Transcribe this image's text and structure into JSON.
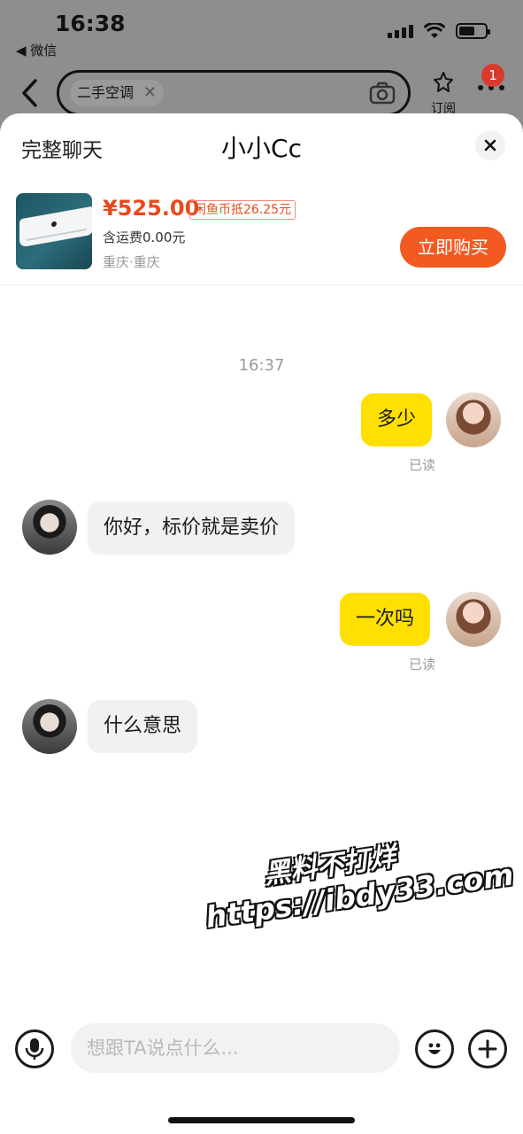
{
  "status_bar": {
    "time": "16:38",
    "back_app": "◀ 微信"
  },
  "search": {
    "query": "二手空调"
  },
  "actions": {
    "subscribe_label": "订阅",
    "notification_count": "1"
  },
  "sheet": {
    "full_chat_label": "完整聊天",
    "title": "小小Cc"
  },
  "product": {
    "price": "¥525.00",
    "coin_discount": "闲鱼币抵26.25元",
    "shipping": "含运费0.00元",
    "location": "重庆·重庆",
    "buy_label": "立即购买"
  },
  "chat": {
    "timestamp": "16:37",
    "messages": [
      {
        "from": "me",
        "text": "多少",
        "status": "已读"
      },
      {
        "from": "other",
        "text": "你好，标价就是卖价"
      },
      {
        "from": "me",
        "text": "一次吗",
        "status": "已读"
      },
      {
        "from": "other",
        "text": "什么意思"
      }
    ]
  },
  "watermark": {
    "line1": "黑料不打烊",
    "line2": "https://ibdy33.com"
  },
  "input": {
    "placeholder": "想跟TA说点什么..."
  },
  "icons": [
    "back-arrow-icon",
    "camera-icon",
    "subscribe-pin-icon",
    "more-icon",
    "close-icon",
    "microphone-icon",
    "emoji-icon",
    "plus-icon"
  ]
}
